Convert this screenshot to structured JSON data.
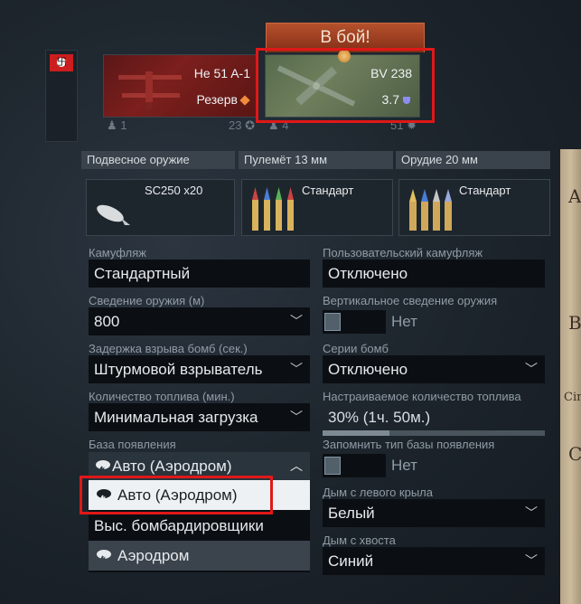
{
  "battle_button": "В бой!",
  "slots": [
    {
      "name": "He 51 A-1",
      "sub": "Резерв",
      "crew": "1",
      "rank": "23",
      "marker_color": "#f08a3c"
    },
    {
      "name": "BV 238",
      "sub": "3.7",
      "crew": "4",
      "rank": "51",
      "marker_color": "#8c8df0"
    }
  ],
  "weapons": {
    "headers": [
      "Подвесное оружие",
      "Пулемёт 13 мм",
      "Орудие 20 мм"
    ],
    "cards": [
      "SC250 x20",
      "Стандарт",
      "Стандарт"
    ]
  },
  "form": {
    "camo_label": "Камуфляж",
    "camo_value": "Стандартный",
    "user_camo_label": "Пользовательский камуфляж",
    "user_camo_value": "Отключено",
    "convergence_label": "Сведение оружия (м)",
    "convergence_value": "800",
    "vert_convergence_label": "Вертикальное сведение оружия",
    "vert_convergence_value": "Нет",
    "bomb_delay_label": "Задержка взрыва бомб (сек.)",
    "bomb_delay_value": "Штурмовой взрыватель",
    "bomb_series_label": "Серии бомб",
    "bomb_series_value": "Отключено",
    "fuel_label": "Количество топлива (мин.)",
    "fuel_value": "Минимальная загрузка",
    "custom_fuel_label": "Настраиваемое количество топлива",
    "custom_fuel_value": "30% (1ч. 50м.)",
    "custom_fuel_fraction": 0.3,
    "spawn_base_label": "База появления",
    "spawn_base_value": "Авто (Аэродром)",
    "remember_spawn_label": "Запомнить тип базы появления",
    "remember_spawn_value": "Нет",
    "left_smoke_label": "Дым с левого крыла",
    "left_smoke_value": "Белый",
    "tail_smoke_label": "Дым с хвоста",
    "tail_smoke_value": "Синий"
  },
  "spawn_options": [
    "Авто (Аэродром)",
    "Выс. бомбардировщики",
    "Аэродром"
  ],
  "map_edge": [
    "A",
    "B",
    "Cin",
    "C"
  ]
}
